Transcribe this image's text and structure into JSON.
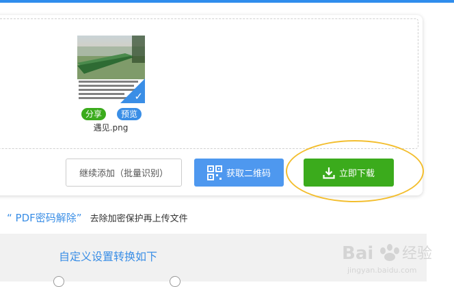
{
  "upload": {
    "file_name": "遇见.png",
    "share_label": "分享",
    "preview_label": "预览"
  },
  "buttons": {
    "add_more": "继续添加（批量识别）",
    "get_qr": "获取二维码",
    "download_now": "立即下载"
  },
  "pdf_section": {
    "quote_open": "“",
    "title": " PDF密码解除",
    "quote_close": "”",
    "description": "去除加密保护再上传文件"
  },
  "settings": {
    "title": "自定义设置转换如下"
  },
  "watermark": {
    "brand": "Bai",
    "brand_cn": "经验",
    "url": "jingyan.baidu.com"
  },
  "colors": {
    "accent_blue": "#3a8ee6",
    "green": "#3bab1c",
    "highlight_ring": "#f3be2e"
  },
  "icons": [
    "check-icon",
    "qr-code-icon",
    "download-icon",
    "radio-icon"
  ]
}
